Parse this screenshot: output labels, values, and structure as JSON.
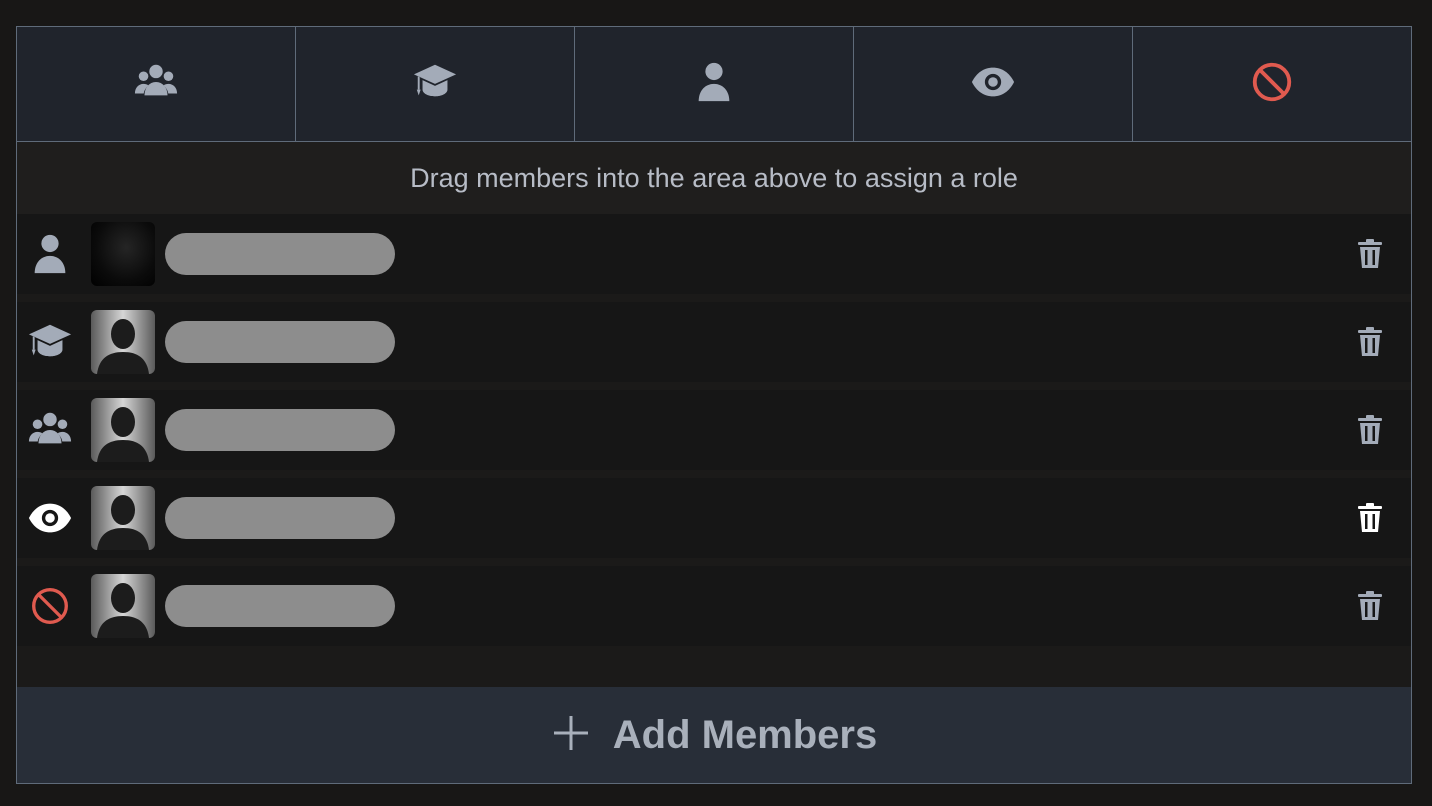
{
  "roles": [
    {
      "name": "groups",
      "icon": "users-icon",
      "color": "#a3abb8"
    },
    {
      "name": "student",
      "icon": "graduation-cap-icon",
      "color": "#a3abb8"
    },
    {
      "name": "member",
      "icon": "user-icon",
      "color": "#a3abb8"
    },
    {
      "name": "viewer",
      "icon": "eye-icon",
      "color": "#a3abb8"
    },
    {
      "name": "blocked",
      "icon": "ban-icon",
      "color": "#e05a4f"
    }
  ],
  "hint_text": "Drag members into the area above to assign a role",
  "members": [
    {
      "role_icon": "user-icon",
      "avatar": "dark-photo",
      "highlighted": false
    },
    {
      "role_icon": "graduation-cap-icon",
      "avatar": "silhouette",
      "highlighted": false
    },
    {
      "role_icon": "users-icon",
      "avatar": "silhouette",
      "highlighted": false
    },
    {
      "role_icon": "eye-icon",
      "avatar": "silhouette",
      "highlighted": true
    },
    {
      "role_icon": "ban-icon",
      "avatar": "silhouette",
      "highlighted": false
    }
  ],
  "add_button": {
    "label": "Add Members",
    "icon": "plus-icon"
  },
  "colors": {
    "icon_default": "#a3abb8",
    "icon_highlight": "#ffffff",
    "ban": "#e05a4f"
  }
}
